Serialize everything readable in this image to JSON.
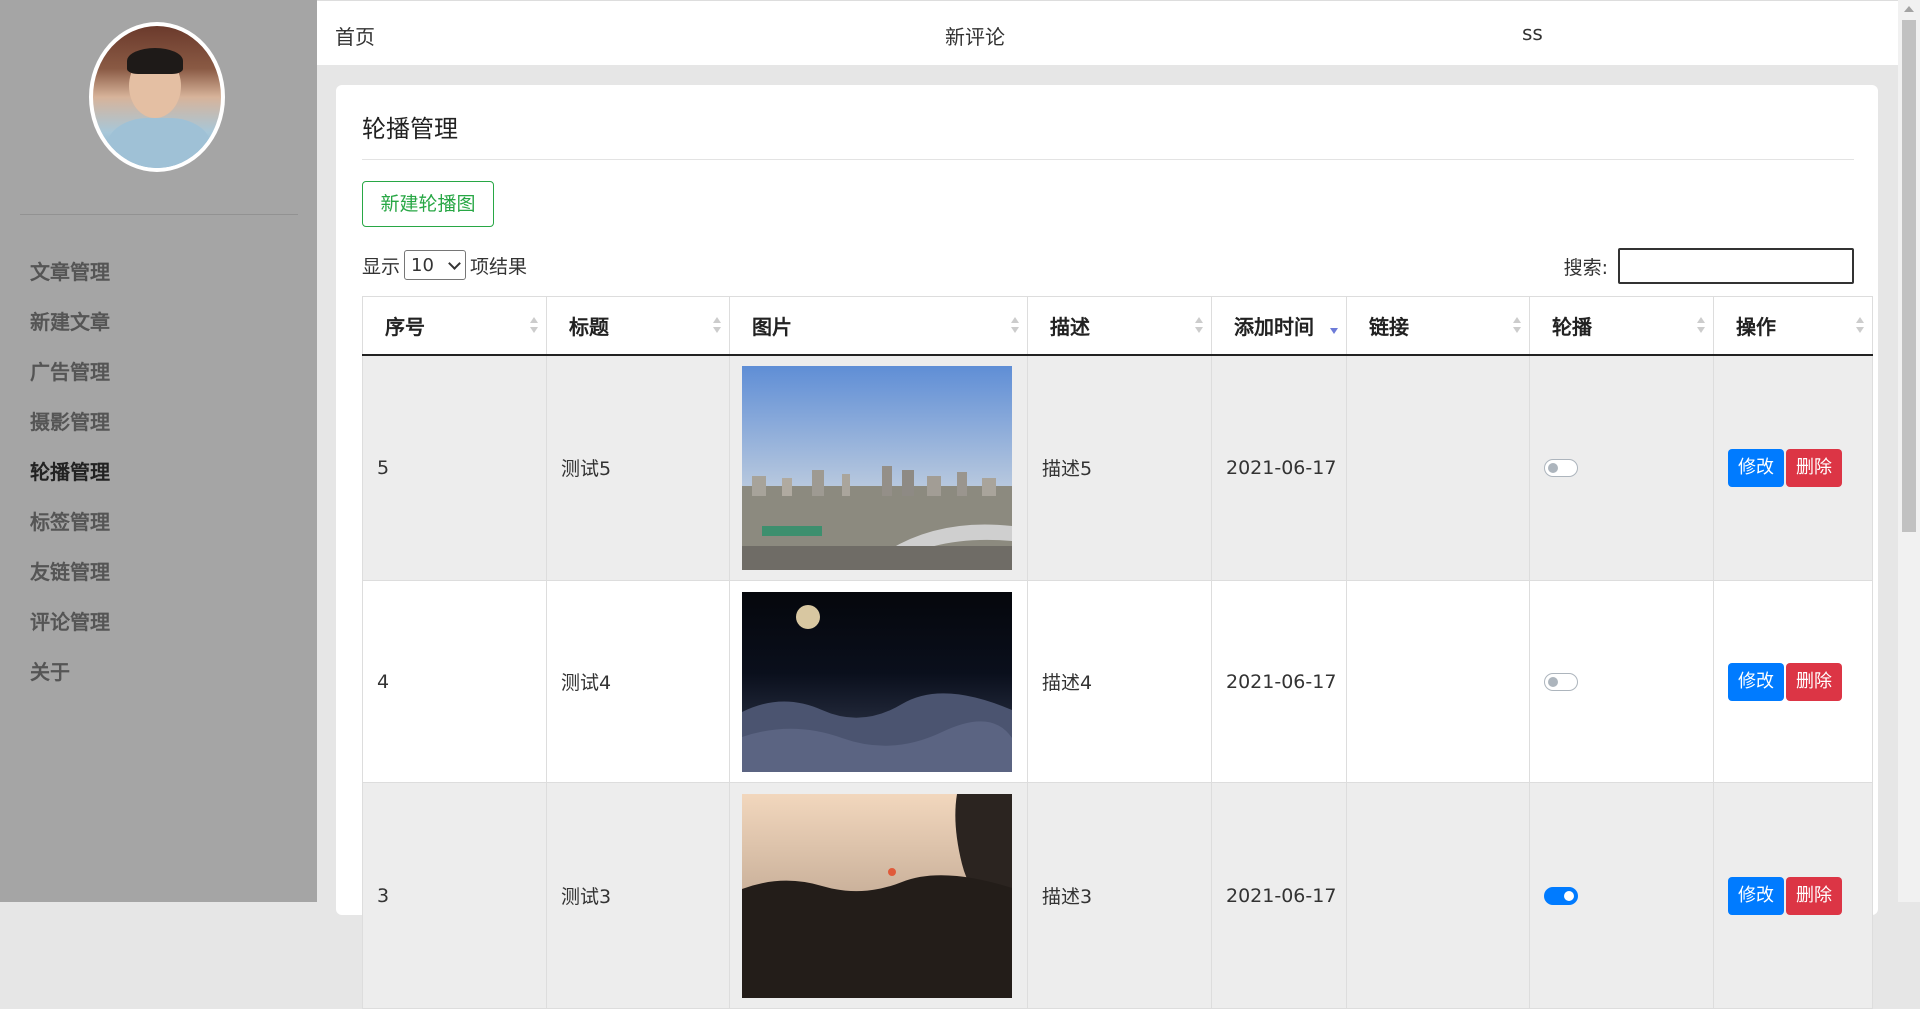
{
  "sidebar": {
    "items": [
      {
        "label": "文章管理"
      },
      {
        "label": "新建文章"
      },
      {
        "label": "广告管理"
      },
      {
        "label": "摄影管理"
      },
      {
        "label": "轮播管理"
      },
      {
        "label": "标签管理"
      },
      {
        "label": "友链管理"
      },
      {
        "label": "评论管理"
      },
      {
        "label": "关于"
      }
    ],
    "active": "轮播管理"
  },
  "topnav": {
    "home": "首页",
    "new_comments": "新评论",
    "user": "ss"
  },
  "main": {
    "title": "轮播管理",
    "new_button": "新建轮播图",
    "length": {
      "prefix": "显示",
      "value": "10",
      "suffix": "项结果"
    },
    "search_label": "搜索:",
    "table": {
      "columns": [
        "序号",
        "标题",
        "图片",
        "描述",
        "添加时间",
        "链接",
        "轮播",
        "操作"
      ],
      "sorted_column": "添加时间",
      "sort_direction": "desc",
      "rows": [
        {
          "id": "5",
          "title": "测试5",
          "image": "city-skyline-photo",
          "desc": "描述5",
          "date": "2021-06-17",
          "link": "",
          "carousel": false,
          "edit": "修改",
          "delete": "删除"
        },
        {
          "id": "4",
          "title": "测试4",
          "image": "moon-over-clouds-photo",
          "desc": "描述4",
          "date": "2021-06-17",
          "link": "",
          "carousel": false,
          "edit": "修改",
          "delete": "删除"
        },
        {
          "id": "3",
          "title": "测试3",
          "image": "sunset-photo",
          "desc": "描述3",
          "date": "2021-06-17",
          "link": "",
          "carousel": true,
          "edit": "修改",
          "delete": "删除"
        }
      ]
    }
  },
  "colors": {
    "sidebar_bg": "#a5a5a5",
    "success": "#28a745",
    "primary": "#007bff",
    "danger": "#dc3545",
    "sort_active": "#6d7bd8"
  }
}
